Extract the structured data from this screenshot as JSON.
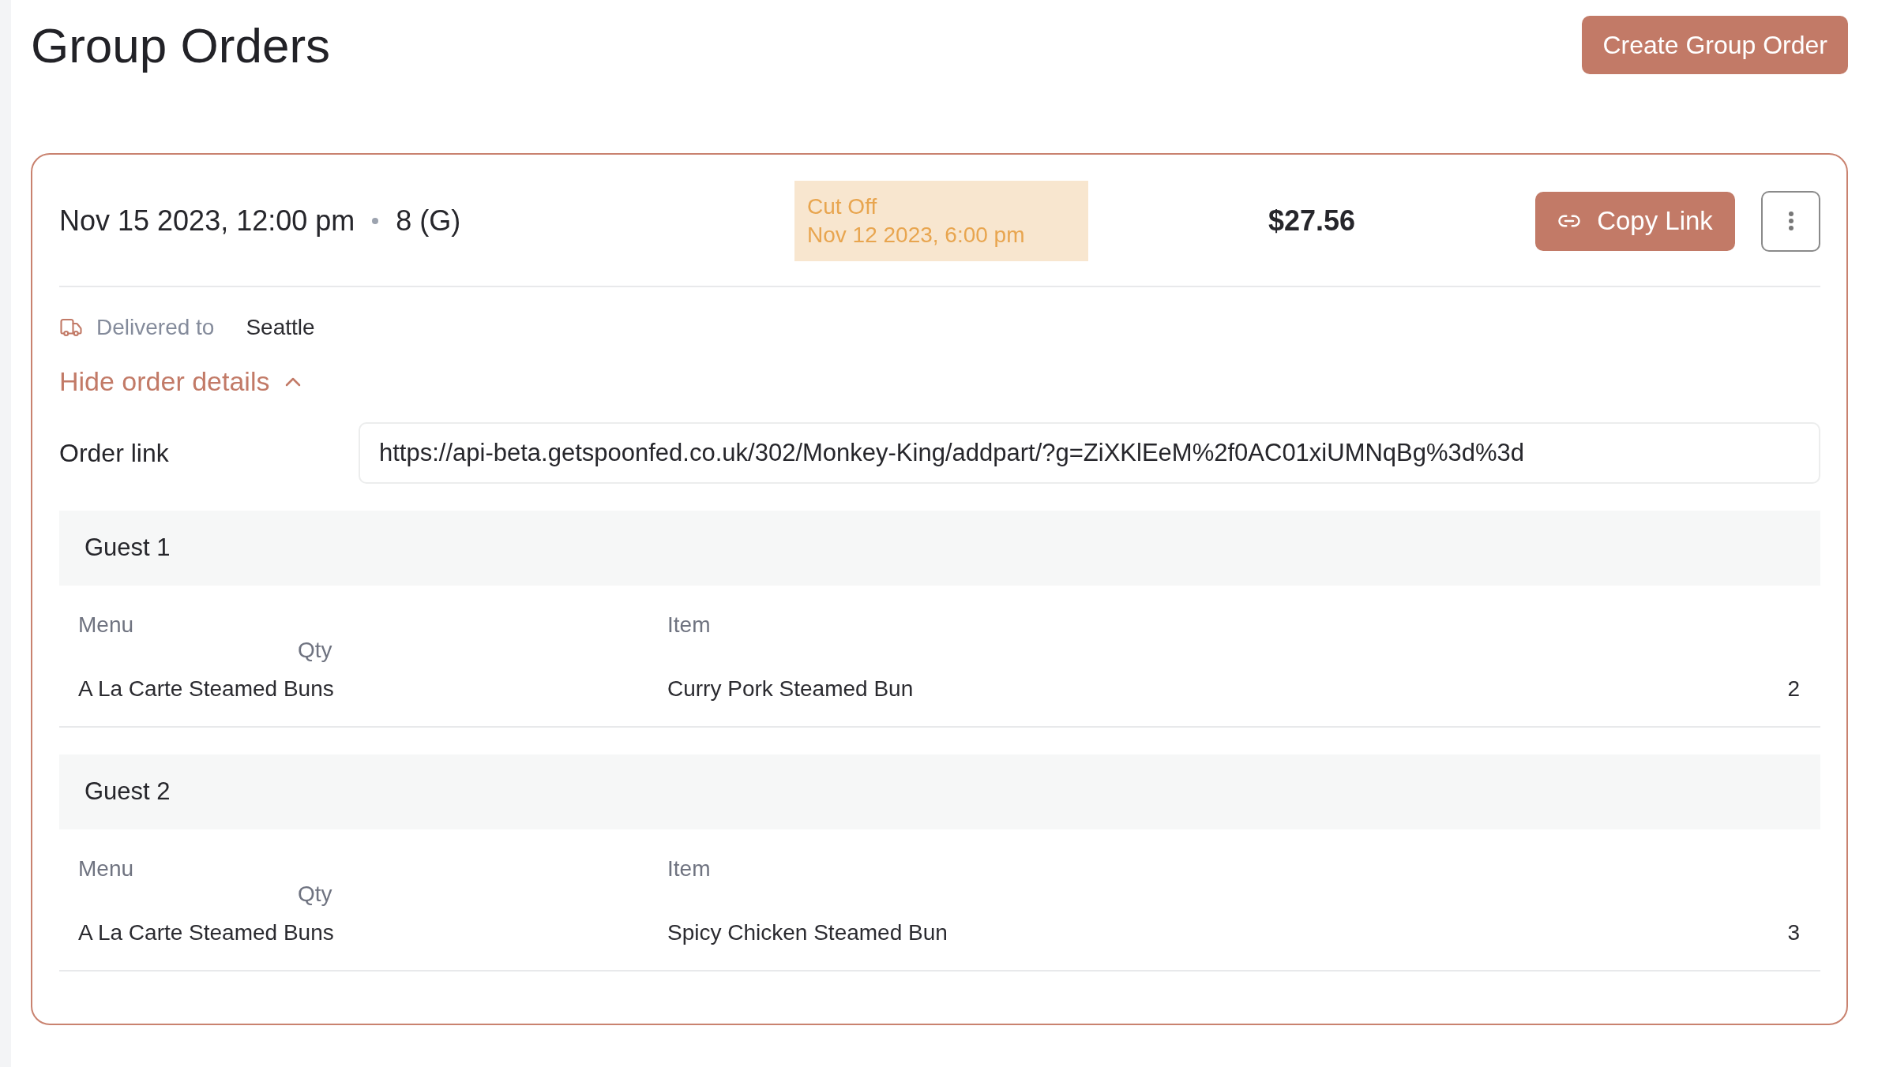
{
  "page": {
    "title": "Group Orders",
    "create_button": "Create Group Order"
  },
  "order": {
    "date": "Nov 15 2023, 12:00 pm",
    "guests": "8 (G)",
    "cutoff": {
      "label": "Cut Off",
      "date": "Nov 12 2023, 6:00 pm"
    },
    "total": "$27.56",
    "copy_button": "Copy Link",
    "delivered_label": "Delivered to",
    "delivered_city": "Seattle",
    "details_toggle": {
      "label": "Hide order details",
      "expanded": true
    },
    "order_link": {
      "label": "Order link",
      "value": "https://api-beta.getspoonfed.co.uk/302/Monkey-King/addpart/?g=ZiXKlEeM%2f0AC01xiUMNqBg%3d%3d"
    },
    "guest_orders": [
      {
        "name": "Guest 1",
        "columns": [
          "Menu",
          "Item",
          "Qty"
        ],
        "rows": [
          {
            "menu": "A La Carte Steamed Buns",
            "item": "Curry Pork Steamed Bun",
            "qty": "2"
          }
        ]
      },
      {
        "name": "Guest 2",
        "columns": [
          "Menu",
          "Item",
          "Qty"
        ],
        "rows": [
          {
            "menu": "A La Carte Steamed Buns",
            "item": "Spicy Chicken Steamed Bun",
            "qty": "3"
          }
        ]
      }
    ]
  }
}
